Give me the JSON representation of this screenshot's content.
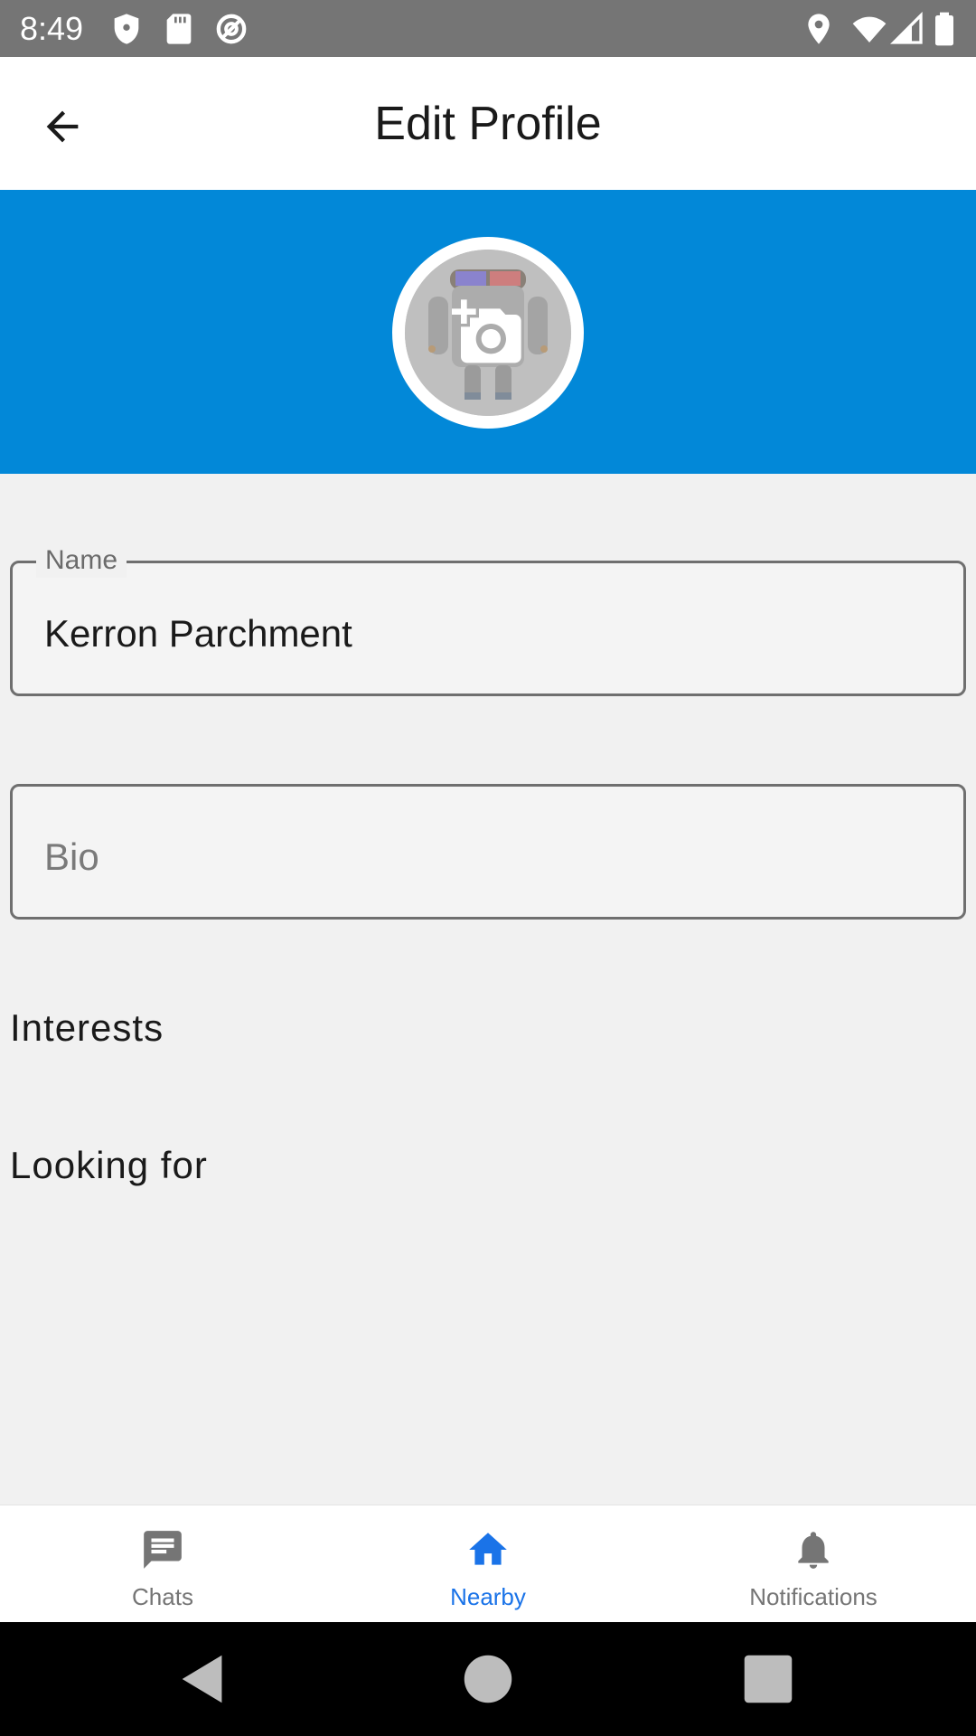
{
  "status_bar": {
    "time": "8:49",
    "left_icons": [
      "shield-icon",
      "sd-card-icon",
      "sync-icon"
    ],
    "right_icons": [
      "location-icon",
      "wifi-icon",
      "signal-icon",
      "battery-icon"
    ]
  },
  "app_bar": {
    "title": "Edit Profile",
    "back_icon": "arrow-back-icon"
  },
  "header": {
    "background_color": "#0288d8",
    "avatar_overlay_icon": "add-a-photo-icon"
  },
  "form": {
    "name": {
      "label": "Name",
      "value": "Kerron Parchment"
    },
    "bio": {
      "placeholder": "Bio",
      "value": ""
    },
    "interests_label": "Interests",
    "looking_for_label": "Looking for"
  },
  "bottom_nav": {
    "active_color": "#1a73e8",
    "inactive_color": "#757575",
    "items": [
      {
        "label": "Chats",
        "icon": "chat-icon",
        "active": false
      },
      {
        "label": "Nearby",
        "icon": "home-icon",
        "active": true
      },
      {
        "label": "Notifications",
        "icon": "bell-icon",
        "active": false
      }
    ]
  },
  "system_nav": {
    "buttons": [
      "back-triangle-icon",
      "home-circle-icon",
      "recents-square-icon"
    ]
  }
}
